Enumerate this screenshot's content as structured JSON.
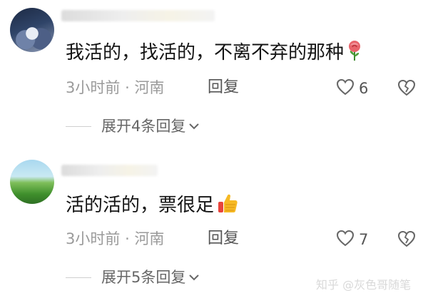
{
  "comments": [
    {
      "text": "我活的，找活的，不离不弃的那种",
      "emoji": "rose-icon",
      "time": "3小时前",
      "separator": "·",
      "location": "河南",
      "reply_label": "回复",
      "like_count": "6",
      "expand_label": "展开4条回复"
    },
    {
      "text": "活的活的，票很足",
      "emoji": "thumbs-up-icon",
      "time": "3小时前",
      "separator": "·",
      "location": "河南",
      "reply_label": "回复",
      "like_count": "7",
      "expand_label": "展开5条回复"
    }
  ],
  "watermark": "知乎 @灰色哥随笔",
  "colors": {
    "text": "#141414",
    "meta": "#9a9a9a",
    "icon": "#666666"
  }
}
